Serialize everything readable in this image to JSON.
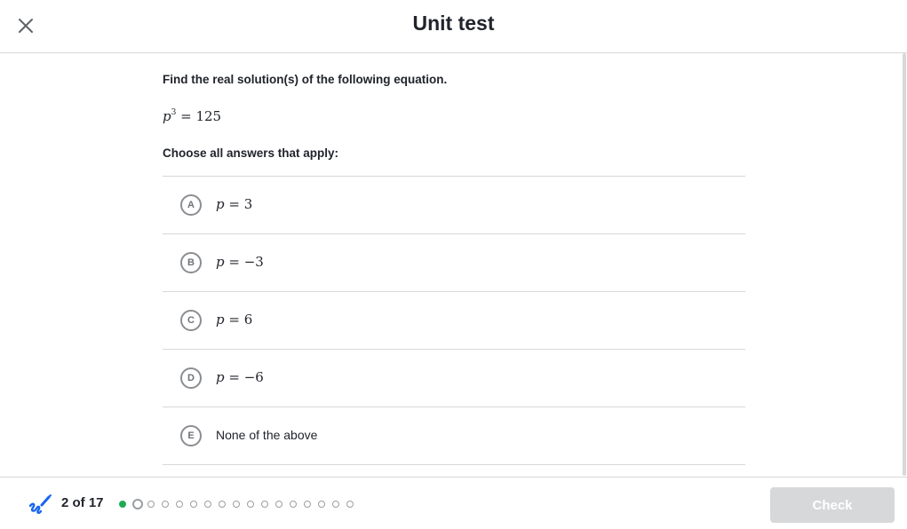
{
  "header": {
    "title": "Unit test",
    "close_icon": "close-icon"
  },
  "question": {
    "prompt": "Find the real solution(s) of the following equation.",
    "equation": {
      "variable": "p",
      "exponent": "3",
      "rhs": "= 125"
    },
    "instructions": "Choose all answers that apply:"
  },
  "choices": [
    {
      "letter": "A",
      "variable": "p",
      "expr": " = 3"
    },
    {
      "letter": "B",
      "variable": "p",
      "expr": " = −3"
    },
    {
      "letter": "C",
      "variable": "p",
      "expr": " = 6"
    },
    {
      "letter": "D",
      "variable": "p",
      "expr": " = −6"
    },
    {
      "letter": "E",
      "text": "None of the above"
    }
  ],
  "footer": {
    "tools_icon": "pencil-scratchpad-icon",
    "progress_label": "2 of 17",
    "current_question": 2,
    "total_questions": 17,
    "check_label": "Check"
  },
  "colors": {
    "accent_done": "#1fab54",
    "border": "#d6d8da",
    "text": "#21242c",
    "button_disabled": "#d6d8da"
  }
}
